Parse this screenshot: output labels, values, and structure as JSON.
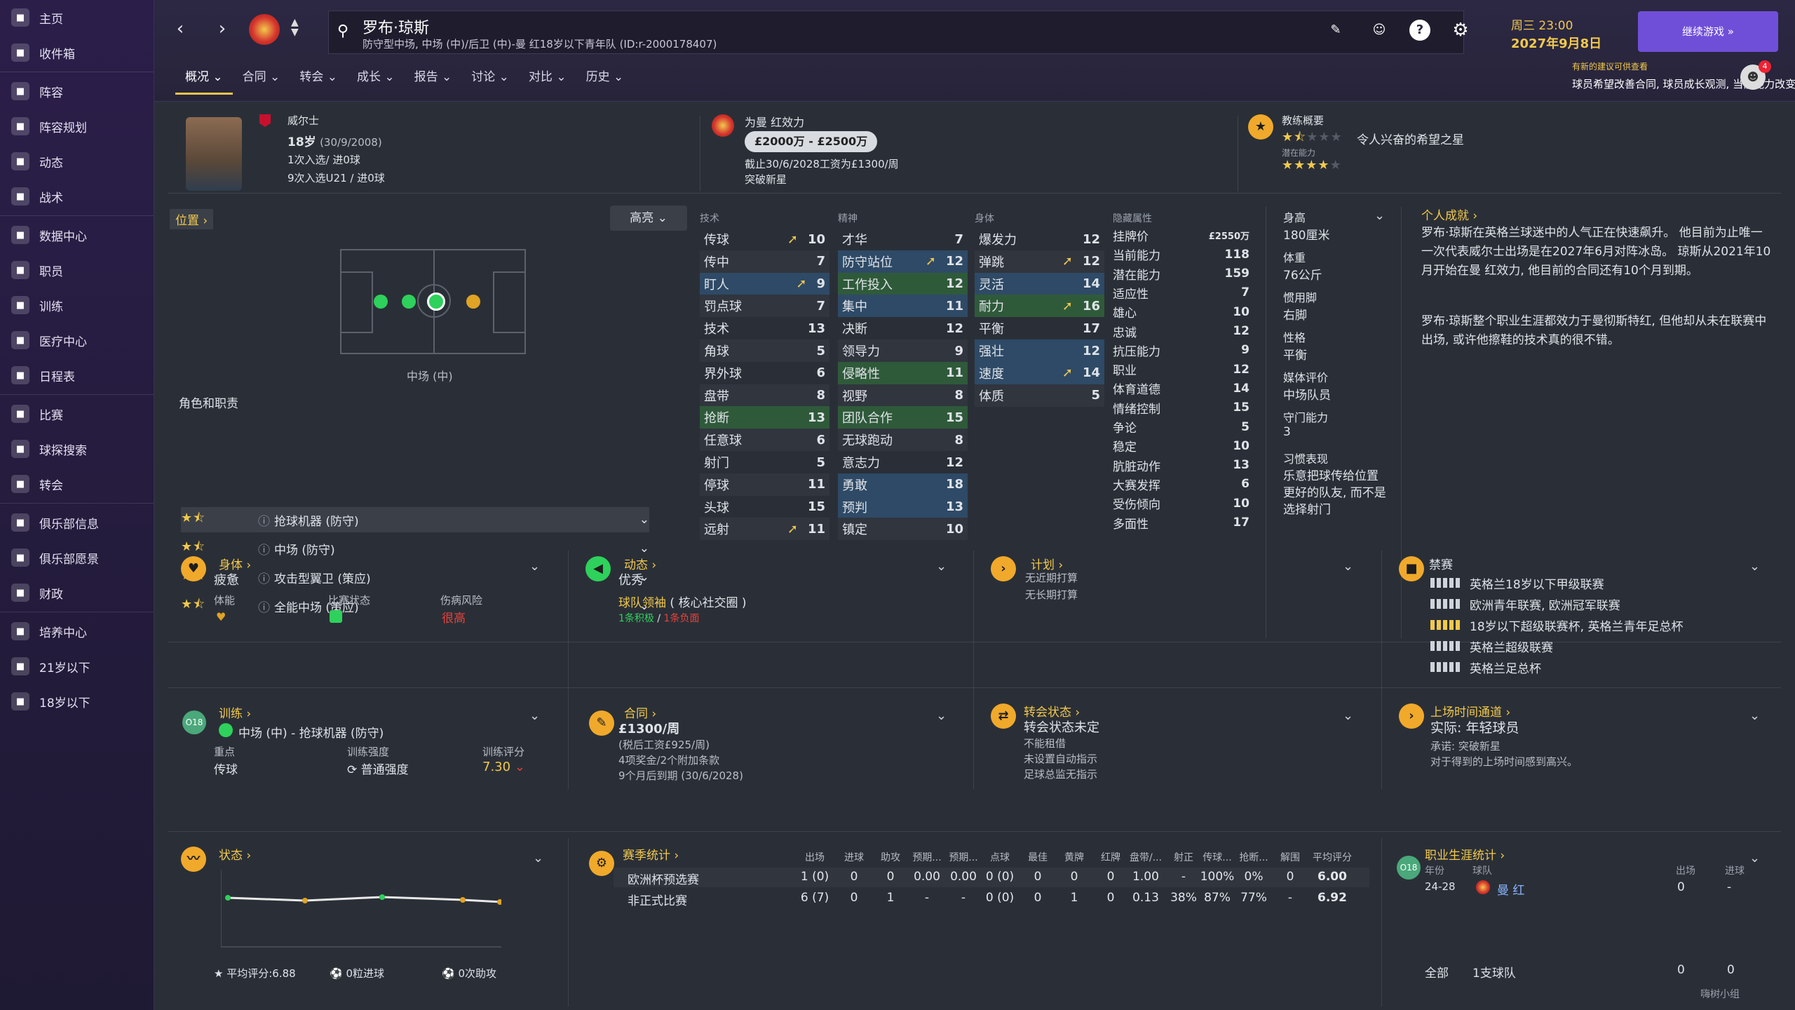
{
  "sidebar": {
    "items": [
      "主页",
      "收件箱",
      "阵容",
      "阵容规划",
      "动态",
      "战术",
      "数据中心",
      "职员",
      "训练",
      "医疗中心",
      "日程表",
      "比赛",
      "球探搜索",
      "转会",
      "俱乐部信息",
      "俱乐部愿景",
      "财政",
      "培养中心",
      "21岁以下",
      "18岁以下"
    ],
    "icons": [
      "home-icon",
      "inbox-icon",
      "squad-icon",
      "squad-planner-icon",
      "dynamics-icon",
      "tactics-icon",
      "data-hub-icon",
      "staff-icon",
      "training-icon",
      "medical-icon",
      "schedule-icon",
      "match-icon",
      "scouting-icon",
      "transfer-icon",
      "club-info-icon",
      "club-vision-icon",
      "finances-icon",
      "dev-centre-icon",
      "u21-icon",
      "u18-icon"
    ]
  },
  "header": {
    "player_name": "罗布·琼斯",
    "player_desc": "防守型中场, 中场 (中)/后卫 (中)-曼 红18岁以下青年队 (ID:r-2000178407)",
    "date_line1": "周三 23:00",
    "date_line2": "2027年9月8日",
    "continue_label": "继续游戏",
    "notice_title": "有新的建议可供查看",
    "notice_text": "球员希望改善合同, 球员成长观测, 当前能力改变, 高潜力球员",
    "notice_count": "4",
    "tabs": [
      "概况",
      "合同",
      "转会",
      "成长",
      "报告",
      "讨论",
      "对比",
      "历史"
    ]
  },
  "profile": {
    "nation": "威尔士",
    "age": "18岁",
    "dob": "(30/9/2008)",
    "caps": "1次入选/ 进0球",
    "caps_u21": "9次入选U21 / 进0球",
    "club_label": "为曼 红效力",
    "wage_range": "£2000万 - £2500万",
    "contract": "截止30/6/2028工资为£1300/周",
    "status": "突破新星",
    "coach_title": "教练概要",
    "coach_note": "令人兴奋的希望之星",
    "potential_label": "潜在能力"
  },
  "position": {
    "label": "位置",
    "selected": "中场 (中)",
    "roles_title": "角色和职责",
    "highlight": "高亮",
    "roles": [
      "抢球机器 (防守)",
      "中场 (防守)",
      "攻击型翼卫 (策应)",
      "全能中场 (策应)"
    ]
  },
  "attributes": {
    "tech_header": "技术",
    "mental_header": "精神",
    "phys_header": "身体",
    "hidden_header": "隐藏属性",
    "technical": [
      {
        "n": "传球",
        "v": "10"
      },
      {
        "n": "传中",
        "v": "7"
      },
      {
        "n": "盯人",
        "v": "9"
      },
      {
        "n": "罚点球",
        "v": "7"
      },
      {
        "n": "技术",
        "v": "13"
      },
      {
        "n": "角球",
        "v": "5"
      },
      {
        "n": "界外球",
        "v": "6"
      },
      {
        "n": "盘带",
        "v": "8"
      },
      {
        "n": "抢断",
        "v": "13"
      },
      {
        "n": "任意球",
        "v": "6"
      },
      {
        "n": "射门",
        "v": "5"
      },
      {
        "n": "停球",
        "v": "11"
      },
      {
        "n": "头球",
        "v": "15"
      },
      {
        "n": "远射",
        "v": "11"
      }
    ],
    "mental": [
      {
        "n": "才华",
        "v": "7"
      },
      {
        "n": "防守站位",
        "v": "12"
      },
      {
        "n": "工作投入",
        "v": "12"
      },
      {
        "n": "集中",
        "v": "11"
      },
      {
        "n": "决断",
        "v": "12"
      },
      {
        "n": "领导力",
        "v": "9"
      },
      {
        "n": "侵略性",
        "v": "11"
      },
      {
        "n": "视野",
        "v": "8"
      },
      {
        "n": "团队合作",
        "v": "15"
      },
      {
        "n": "无球跑动",
        "v": "8"
      },
      {
        "n": "意志力",
        "v": "12"
      },
      {
        "n": "勇敢",
        "v": "18"
      },
      {
        "n": "预判",
        "v": "13"
      },
      {
        "n": "镇定",
        "v": "10"
      }
    ],
    "physical": [
      {
        "n": "爆发力",
        "v": "12"
      },
      {
        "n": "弹跳",
        "v": "12"
      },
      {
        "n": "灵活",
        "v": "14"
      },
      {
        "n": "耐力",
        "v": "16"
      },
      {
        "n": "平衡",
        "v": "17"
      },
      {
        "n": "强壮",
        "v": "12"
      },
      {
        "n": "速度",
        "v": "14"
      },
      {
        "n": "体质",
        "v": "5"
      }
    ],
    "hidden": [
      {
        "n": "挂牌价",
        "v": "£2550万"
      },
      {
        "n": "当前能力",
        "v": "118"
      },
      {
        "n": "潜在能力",
        "v": "159"
      },
      {
        "n": "适应性",
        "v": "7"
      },
      {
        "n": "雄心",
        "v": "10"
      },
      {
        "n": "忠诚",
        "v": "12"
      },
      {
        "n": "抗压能力",
        "v": "9"
      },
      {
        "n": "职业",
        "v": "12"
      },
      {
        "n": "体育道德",
        "v": "14"
      },
      {
        "n": "情绪控制",
        "v": "15"
      },
      {
        "n": "争论",
        "v": "5"
      },
      {
        "n": "稳定",
        "v": "10"
      },
      {
        "n": "肮脏动作",
        "v": "13"
      },
      {
        "n": "大赛发挥",
        "v": "6"
      },
      {
        "n": "受伤倾向",
        "v": "10"
      },
      {
        "n": "多面性",
        "v": "17"
      }
    ]
  },
  "details": {
    "height_label": "身高",
    "height": "180厘米",
    "weight_label": "体重",
    "weight": "76公斤",
    "foot_label": "惯用脚",
    "foot": "右脚",
    "personality_label": "性格",
    "personality": "平衡",
    "media_label": "媒体评价",
    "media": "中场队员",
    "gk_label": "守门能力",
    "gk": "3",
    "habits_label": "习惯表现",
    "habits": "乐意把球传给位置更好的队友, 而不是选择射门"
  },
  "bio": {
    "title": "个人成就",
    "p1": "罗布·琼斯在英格兰球迷中的人气正在快速飙升。 他目前为止唯一一次代表威尔士出场是在2027年6月对阵冰岛。 琼斯从2021年10月开始在曼 红效力, 他目前的合同还有10个月到期。",
    "p2": "罗布·琼斯整个职业生涯都效力于曼彻斯特红, 但他却从未在联赛中出场, 或许他擦鞋的技术真的很不错。"
  },
  "body_panel": {
    "title": "身体",
    "state": "疲惫",
    "c1": "体能",
    "c2": "比赛状态",
    "c3": "伤病风险",
    "risk": "很高"
  },
  "dynamics_panel": {
    "title": "动态",
    "state": "优秀",
    "role": "球队领袖",
    "group": "( 核心社交圈 )",
    "pos": "1条积极",
    "neg": "1条负面"
  },
  "plan_panel": {
    "title": "计划",
    "l1": "无近期打算",
    "l2": "无长期打算"
  },
  "bans_panel": {
    "title": "禁赛",
    "items": [
      "英格兰18岁以下甲级联赛",
      "欧洲青年联赛, 欧洲冠军联赛",
      "18岁以下超级联赛杯, 英格兰青年足总杯",
      "英格兰超级联赛",
      "英格兰足总杯"
    ]
  },
  "training_panel": {
    "title": "训练",
    "role": "中场 (中) - 抢球机器 (防守)",
    "focus_label": "重点",
    "focus": "传球",
    "intensity_label": "训练强度",
    "intensity": "普通强度",
    "rating_label": "训练评分",
    "rating": "7.30",
    "badge": "O18"
  },
  "contract_panel": {
    "title": "合同",
    "wage": "£1300/周",
    "l1": "(税后工资£925/周)",
    "l2": "4项奖金/2个附加条款",
    "l3": "9个月后到期 (30/6/2028)"
  },
  "transfer_panel": {
    "title": "转会状态",
    "state": "转会状态未定",
    "l1": "不能租借",
    "l2": "未设置自动指示",
    "l3": "足球总监无指示"
  },
  "playtime_panel": {
    "title": "上场时间通道",
    "state": "实际: 年轻球员",
    "l1": "承诺: 突破新星",
    "l2": "对于得到的上场时间感到高兴。"
  },
  "form_panel": {
    "title": "状态",
    "avg": "平均评分:6.88",
    "goals": "0粒进球",
    "assists": "0次助攻"
  },
  "season_stats": {
    "title": "赛季统计",
    "headers": [
      "出场",
      "进球",
      "助攻",
      "预期...",
      "预期...",
      "点球",
      "最佳",
      "黄牌",
      "红牌",
      "盘带/...",
      "射正",
      "传球...",
      "抢断...",
      "解围",
      "平均评分"
    ],
    "rows": [
      {
        "comp": "欧洲杯预选赛",
        "vals": [
          "1 (0)",
          "0",
          "0",
          "0.00",
          "0.00",
          "0 (0)",
          "0",
          "0",
          "0",
          "1.00",
          "-",
          "100%",
          "0%",
          "0",
          "6.00"
        ]
      },
      {
        "comp": "非正式比赛",
        "vals": [
          "6 (7)",
          "0",
          "1",
          "-",
          "-",
          "0 (0)",
          "0",
          "1",
          "0",
          "0.13",
          "38%",
          "87%",
          "77%",
          "-",
          "6.92"
        ]
      }
    ]
  },
  "career_stats": {
    "title": "职业生涯统计",
    "badge": "O18",
    "col_year": "年份",
    "col_team": "球队",
    "col_apps": "出场",
    "col_goals": "进球",
    "year": "24-28",
    "team": "曼 红",
    "apps": "0",
    "goals": "-",
    "total_label": "全部",
    "total_team": "1支球队",
    "total_apps": "0",
    "total_goals": "0"
  },
  "watermark": "嗨树小组"
}
